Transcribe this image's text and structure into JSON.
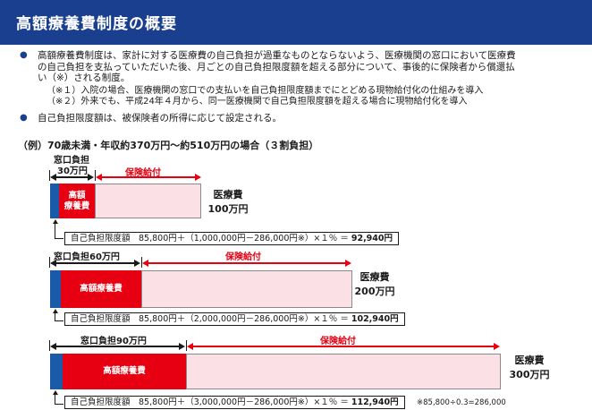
{
  "header": {
    "title": "高額療養費制度の概要"
  },
  "bullets": [
    {
      "lines": [
        "高額療養費制度は、家計に対する医療費の自己負担が過重なものとならないよう、医療機関の窓口において医療費",
        "の自己負担を支払っていただいた後、月ごとの自己負担限度額を超える部分について、事後的に保険者から償還払",
        "い（※）される制度。"
      ],
      "notes": [
        "（※１）入院の場合、医療機関の窓口での支払いを自己負担限度額までにとどめる現物給付化の仕組みを導入",
        "（※２）外来でも、平成24年４月から、同一医療機関で自己負担限度額を超える場合に現物給付化を導入"
      ]
    },
    {
      "lines": [
        "自己負担限度額は、被保険者の所得に応じて設定される。"
      ]
    }
  ],
  "example_title": "（例）70歳未満・年収約370万円～約510万円の場合（３割負担）",
  "examples": [
    {
      "window_label_line1": "窓口負担",
      "window_label_line2": "30万円",
      "insurance_label": "保険給付",
      "red_label_line1": "高額",
      "red_label_line2": "療養費",
      "cost_label": "医療費",
      "cost_amount": "100万円",
      "formula_text": "自己負担限度額　85,800円＋（1,000,000円－286,000円※）×１％ ＝ ",
      "formula_result": "92,940円"
    },
    {
      "window_label": "窓口負担60万円",
      "insurance_label": "保険給付",
      "red_label": "高額療養費",
      "cost_label": "医療費",
      "cost_amount": "200万円",
      "formula_text": "自己負担限度額　85,800円＋（2,000,000円－286,000円※）×１％ ＝ ",
      "formula_result": "102,940円"
    },
    {
      "window_label": "窓口負担90万円",
      "insurance_label": "保険給付",
      "red_label": "高額療養費",
      "cost_label": "医療費",
      "cost_amount": "300万円",
      "formula_text": "自己負担限度額　85,800円＋（3,000,000円－286,000円※）×１％ ＝ ",
      "formula_result": "112,940円"
    }
  ],
  "footnote": "※85,800÷0.3=286,000",
  "colors": {
    "header": "#1a3f8f",
    "blue": "#1a5aa8",
    "red": "#e60012",
    "pink": "#fbe1e6"
  }
}
